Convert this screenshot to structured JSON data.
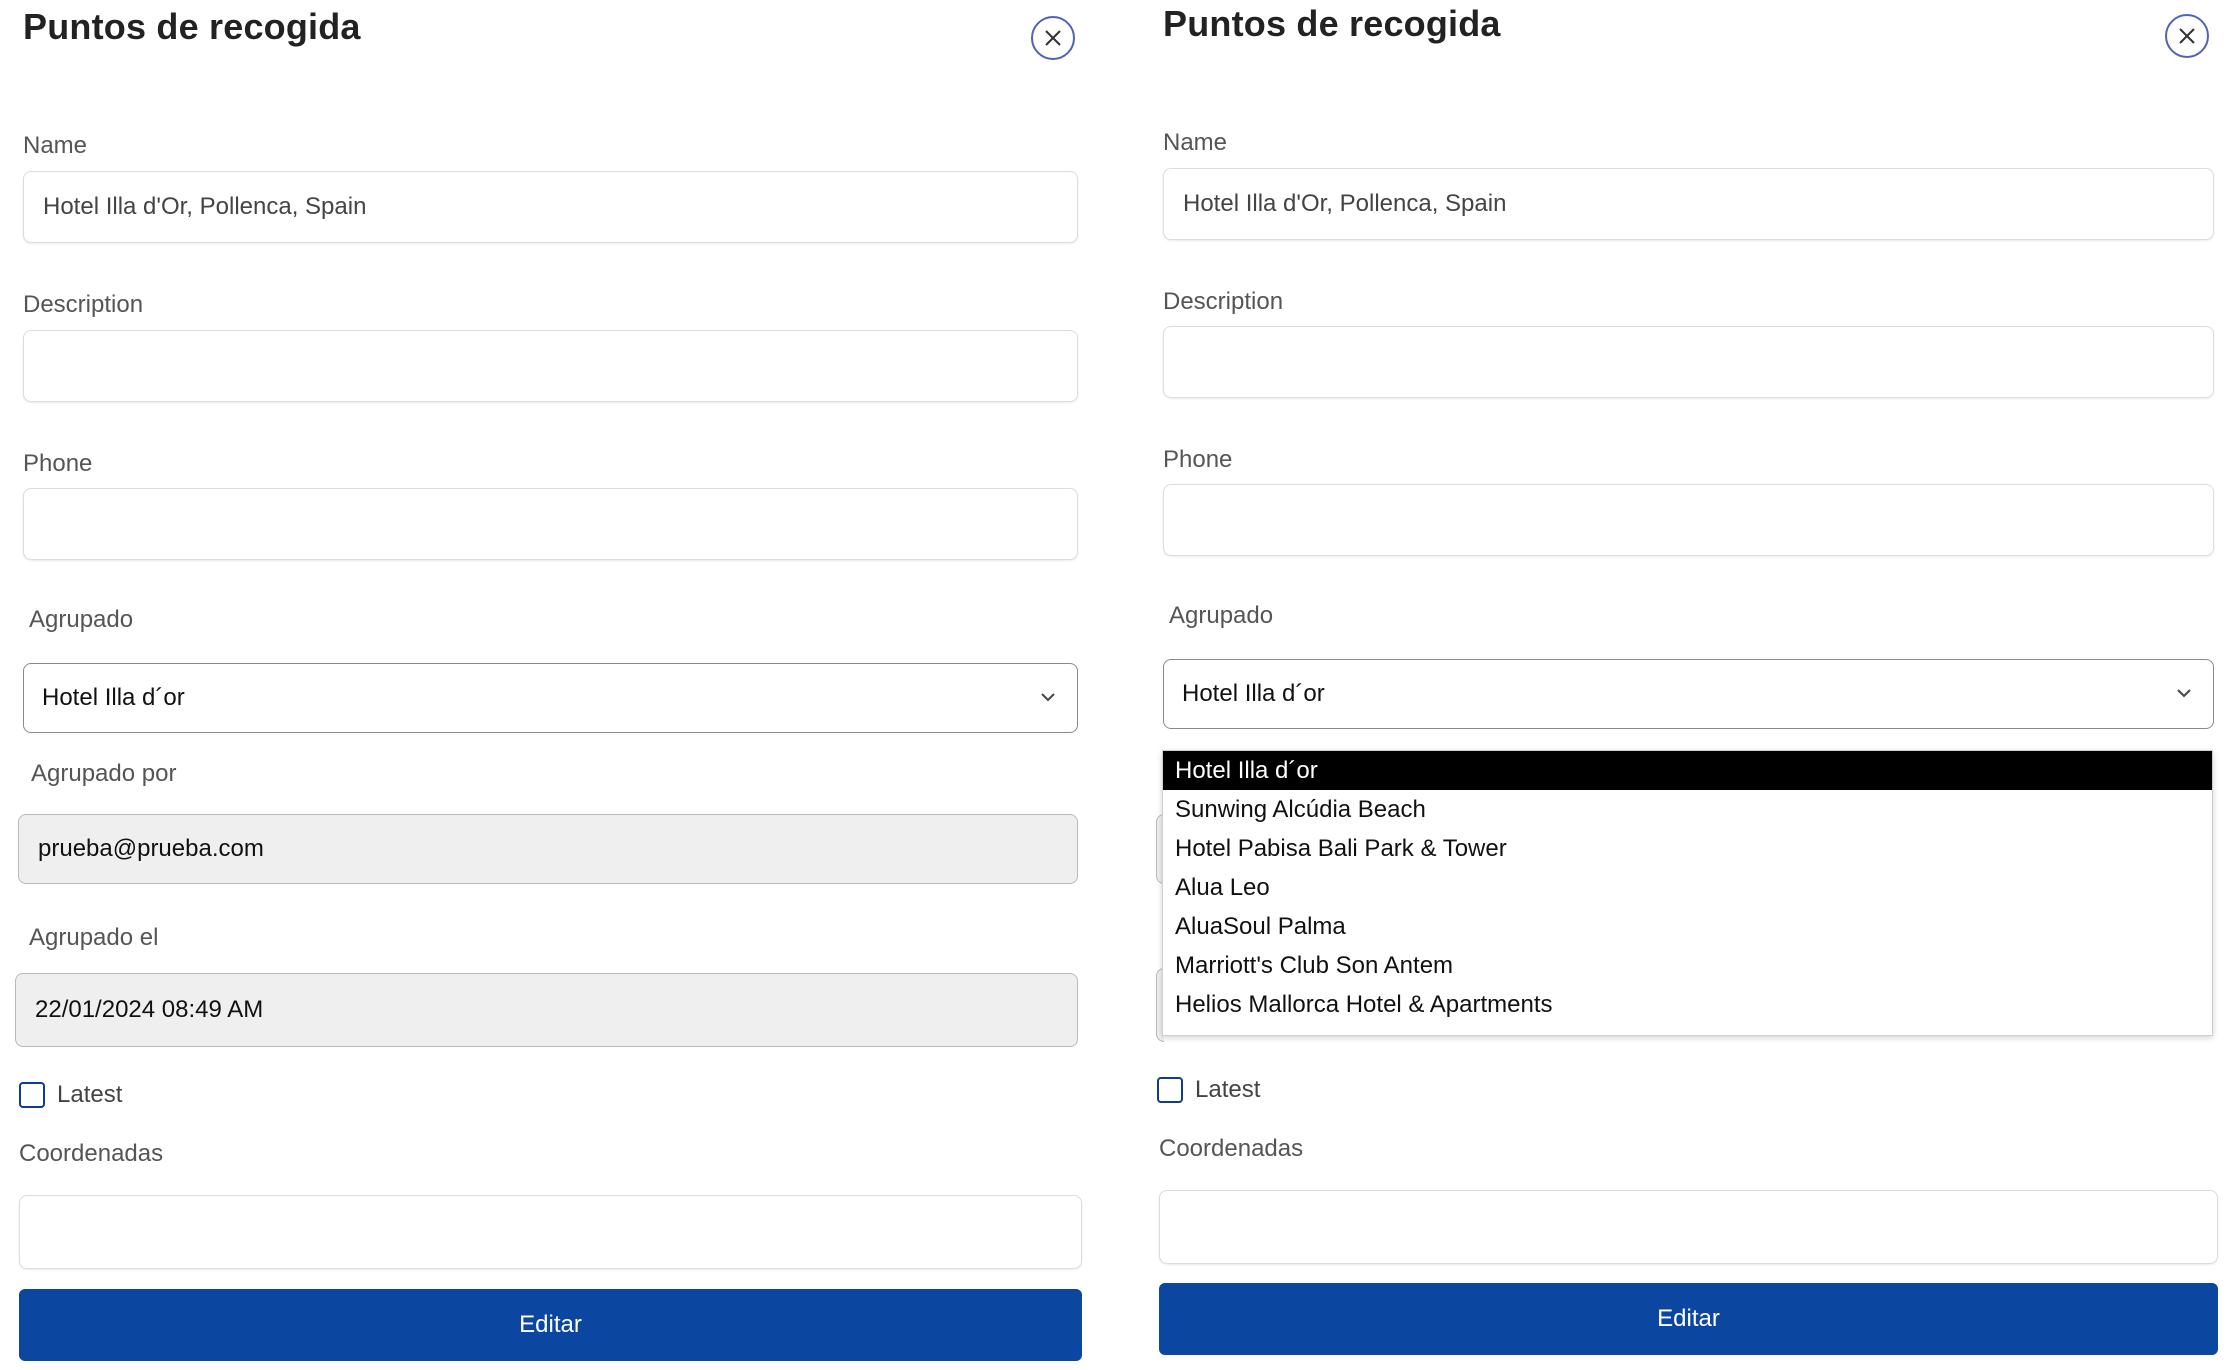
{
  "panels": [
    {
      "title": "Puntos de recogida",
      "close_icon": "close-icon",
      "name_label": "Name",
      "name_value": "Hotel Illa d'Or, Pollenca, Spain",
      "description_label": "Description",
      "description_value": "",
      "phone_label": "Phone",
      "phone_value": "",
      "agrupado_label": "Agrupado",
      "agrupado_value": "Hotel Illa d´or",
      "agrupado_por_label": "Agrupado por",
      "agrupado_por_value": "prueba@prueba.com",
      "agrupado_el_label": "Agrupado el",
      "agrupado_el_value": "22/01/2024 08:49 AM",
      "latest_label": "Latest",
      "latest_checked": false,
      "coordenadas_label": "Coordenadas",
      "coordenadas_value": "",
      "submit_label": "Editar"
    },
    {
      "title": "Puntos de recogida",
      "close_icon": "close-icon",
      "name_label": "Name",
      "name_value": "Hotel Illa d'Or, Pollenca, Spain",
      "description_label": "Description",
      "description_value": "",
      "phone_label": "Phone",
      "phone_value": "",
      "agrupado_label": "Agrupado",
      "agrupado_value": "Hotel Illa d´or",
      "dropdown_open": true,
      "dropdown_options": [
        "Hotel Illa d´or",
        "Sunwing Alcúdia Beach",
        "Hotel Pabisa Bali Park & Tower",
        "Alua Leo",
        "AluaSoul Palma",
        "Marriott's Club Son Antem",
        "Helios Mallorca Hotel & Apartments"
      ],
      "dropdown_selected_index": 0,
      "latest_label": "Latest",
      "latest_checked": false,
      "coordenadas_label": "Coordenadas",
      "coordenadas_value": "",
      "submit_label": "Editar"
    }
  ],
  "colors": {
    "primary_button": "#0b47a1",
    "close_ring": "#4f63b8",
    "checkbox_border": "#0f3d8c",
    "readonly_bg": "#efefef",
    "selected_option_bg": "#000000"
  }
}
